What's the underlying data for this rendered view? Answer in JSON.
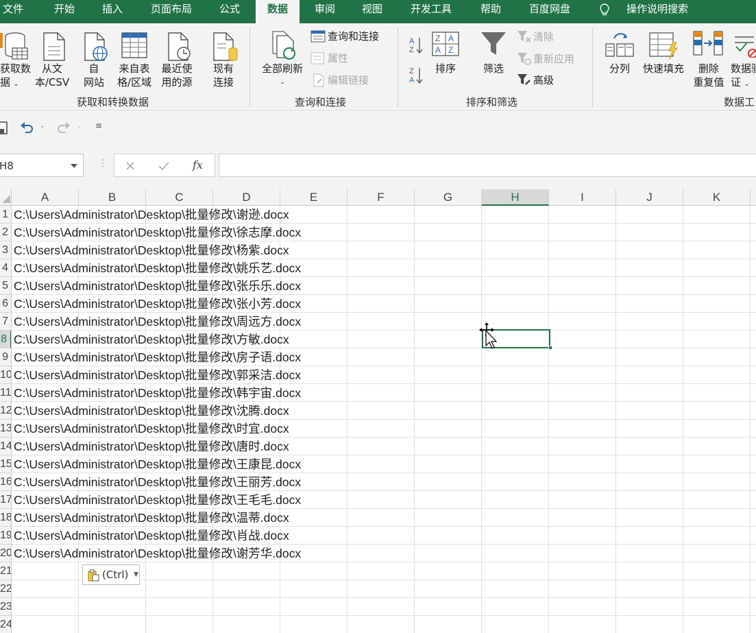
{
  "tabs": [
    {
      "label": "文件",
      "active": false
    },
    {
      "label": "开始",
      "active": false
    },
    {
      "label": "插入",
      "active": false
    },
    {
      "label": "页面布局",
      "active": false
    },
    {
      "label": "公式",
      "active": false
    },
    {
      "label": "数据",
      "active": true
    },
    {
      "label": "审阅",
      "active": false
    },
    {
      "label": "视图",
      "active": false
    },
    {
      "label": "开发工具",
      "active": false
    },
    {
      "label": "帮助",
      "active": false
    },
    {
      "label": "百度网盘",
      "active": false
    }
  ],
  "tell_me": "操作说明搜索",
  "ribbon": {
    "get_data": {
      "line1": "获取数",
      "line2": "据"
    },
    "from_text": {
      "line1": "从文",
      "line2": "本/CSV"
    },
    "from_web": {
      "line1": "自",
      "line2": "网站"
    },
    "from_table": {
      "line1": "来自表",
      "line2": "格/区域"
    },
    "recent_sources": {
      "line1": "最近使",
      "line2": "用的源"
    },
    "existing_conn": {
      "line1": "现有",
      "line2": "连接"
    },
    "group_get": "获取和转换数据",
    "refresh_all": "全部刷新",
    "queries_conn": "查询和连接",
    "properties": "属性",
    "edit_links": "编辑链接",
    "group_queries": "查询和连接",
    "sort": "排序",
    "filter": "筛选",
    "clear": "清除",
    "reapply": "重新应用",
    "advanced": "高级",
    "group_sort": "排序和筛选",
    "text_to_cols": "分列",
    "flash_fill": "快速填充",
    "remove_dup": {
      "line1": "删除",
      "line2": "重复值"
    },
    "data_valid": {
      "line1": "数据验",
      "line2": "证"
    },
    "group_tools": "数据工"
  },
  "formula_bar": {
    "name_box": "H8",
    "fx": "fx",
    "value": ""
  },
  "columns": [
    "A",
    "B",
    "C",
    "D",
    "E",
    "F",
    "G",
    "H",
    "I",
    "J",
    "K"
  ],
  "selected_column": "H",
  "selected_row": 8,
  "rows": [
    "1",
    "2",
    "3",
    "4",
    "5",
    "6",
    "7",
    "8",
    "9",
    "10",
    "11",
    "12",
    "13",
    "14",
    "15",
    "16",
    "17",
    "18",
    "19",
    "20",
    "21",
    "22",
    "23",
    "24"
  ],
  "cells_a": [
    "C:\\Users\\Administrator\\Desktop\\批量修改\\谢逊.docx",
    "C:\\Users\\Administrator\\Desktop\\批量修改\\徐志摩.docx",
    "C:\\Users\\Administrator\\Desktop\\批量修改\\杨紫.docx",
    "C:\\Users\\Administrator\\Desktop\\批量修改\\姚乐艺.docx",
    "C:\\Users\\Administrator\\Desktop\\批量修改\\张乐乐.docx",
    "C:\\Users\\Administrator\\Desktop\\批量修改\\张小芳.docx",
    "C:\\Users\\Administrator\\Desktop\\批量修改\\周远方.docx",
    "C:\\Users\\Administrator\\Desktop\\批量修改\\方敏.docx",
    "C:\\Users\\Administrator\\Desktop\\批量修改\\房子语.docx",
    "C:\\Users\\Administrator\\Desktop\\批量修改\\郭采洁.docx",
    "C:\\Users\\Administrator\\Desktop\\批量修改\\韩宇宙.docx",
    "C:\\Users\\Administrator\\Desktop\\批量修改\\沈腾.docx",
    "C:\\Users\\Administrator\\Desktop\\批量修改\\时宜.docx",
    "C:\\Users\\Administrator\\Desktop\\批量修改\\唐时.docx",
    "C:\\Users\\Administrator\\Desktop\\批量修改\\王康昆.docx",
    "C:\\Users\\Administrator\\Desktop\\批量修改\\王丽芳.docx",
    "C:\\Users\\Administrator\\Desktop\\批量修改\\王毛毛.docx",
    "C:\\Users\\Administrator\\Desktop\\批量修改\\温蒂.docx",
    "C:\\Users\\Administrator\\Desktop\\批量修改\\肖战.docx",
    "C:\\Users\\Administrator\\Desktop\\批量修改\\谢芳华.docx"
  ],
  "paste_options": "(Ctrl)",
  "colors": {
    "accent": "#217346",
    "ribbon_bg": "#f3f3f3",
    "grid": "#e1e1e1"
  }
}
